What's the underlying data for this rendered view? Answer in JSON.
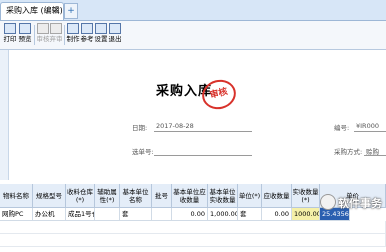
{
  "tabs": [
    {
      "label": "采购入库 (编辑)",
      "close": "×"
    }
  ],
  "tab_add_symbol": "+",
  "toolbar": {
    "items": [
      {
        "label": "打印",
        "icon": "printer-icon",
        "enabled": true
      },
      {
        "label": "预览",
        "icon": "preview-icon",
        "enabled": true
      },
      {
        "label": "审核",
        "icon": "audit-icon",
        "enabled": false
      },
      {
        "label": "弃审",
        "icon": "unaudit-icon",
        "enabled": false
      },
      {
        "label": "制作",
        "icon": "make-icon",
        "enabled": true
      },
      {
        "label": "参考",
        "icon": "reference-icon",
        "enabled": true
      },
      {
        "label": "设置",
        "icon": "settings-icon",
        "enabled": true
      },
      {
        "label": "退出",
        "icon": "exit-icon",
        "enabled": true
      }
    ]
  },
  "document": {
    "title": "采购入库",
    "stamp": "审核",
    "date_label": "日期:",
    "date_value": "2017-08-28",
    "number_label": "编号:",
    "number_value": "¥IR000",
    "source_label": "选单号:",
    "purchase_label": "采购方式:",
    "purchase_value": "赊购"
  },
  "grid": {
    "columns": [
      "物料名称",
      "规格型号",
      "收料仓库(*)",
      "辅助属性(*)",
      "基本单位名称",
      "批号",
      "基本单位应收数量",
      "基本单位实收数量",
      "单位(*)",
      "应收数量",
      "实收数量(*)",
      "单价"
    ],
    "rows": [
      [
        "网购PC",
        "办公机",
        "成品1号仓",
        "",
        "套",
        "",
        "0.00",
        "1,000.00",
        "套",
        "0.00",
        "1000.00",
        "25.4356"
      ]
    ]
  },
  "watermark": {
    "text": "软件事务"
  },
  "colors": {
    "stamp": "#d8322b",
    "header_bg": "#e4edf8",
    "highlight_yellow": "#f5f0a8",
    "highlight_blue": "#2a5fb0"
  }
}
